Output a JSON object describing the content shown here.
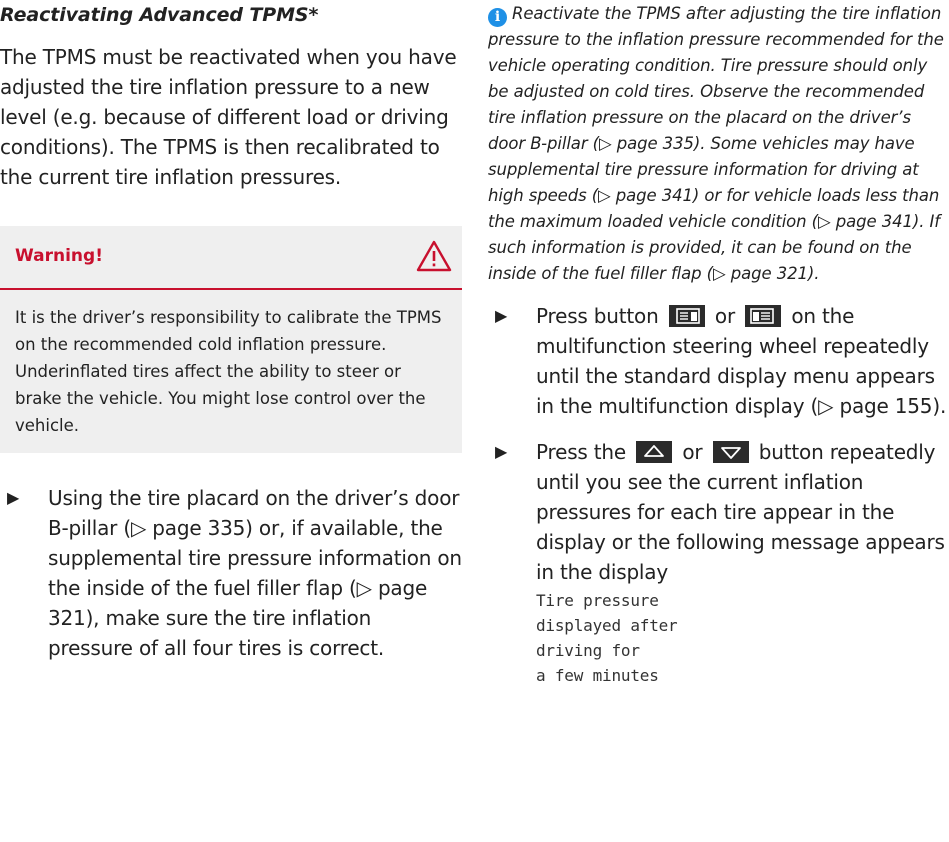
{
  "left": {
    "title": "Reactivating Advanced TPMS*",
    "intro": "The TPMS must be reactivated when you have adjusted the tire inflation pressure to a new level (e.g. because of different load or driving conditions). The TPMS is then recalibrated to the current tire inflation pressures.",
    "warning": {
      "label": "Warning!",
      "text": "It is the driver’s responsibility to calibrate the TPMS on the recommended cold inflation pressure. Underinflated tires affect the ability to steer or brake the vehicle. You might lose control over the vehicle."
    },
    "step": "Using the tire placard on the driver’s door B-pillar (▷ page 335) or, if available, the supplemental tire pressure information on the inside of the fuel filler flap (▷ page 321), make sure the tire inflation pressure of all four tires is correct."
  },
  "right": {
    "note": "Reactivate the TPMS after adjusting the tire inflation pressure to the inflation pressure recommended for the vehicle operating condition. Tire pressure should only be adjusted on cold tires. Observe the recommended tire inflation pressure on the placard on the driver’s door B-pillar (▷ page 335). Some vehicles may have supplemental tire pressure information for driving at high speeds (▷ page 341) or for vehicle loads less than the maximum loaded vehicle condition (▷ page 341). If such information is provided, it can be found on the inside of the fuel filler flap (▷ page 321).",
    "step1": {
      "before": "Press button",
      "or": "or",
      "after": "on the multifunction steering wheel repeatedly until the standard display menu appears in the multifunction display (▷ page 155)."
    },
    "step2": {
      "before": "Press the",
      "or": "or",
      "after": "button repeatedly until you see the current inflation pressures for each tire appear in the display or the following message appears in the display",
      "message": "Tire pressure\ndisplayed after\ndriving for\na few minutes"
    }
  },
  "icons": {
    "bullet": "▶",
    "info": "i",
    "warning": "warning-triangle-icon",
    "page_back": "display-page-back-icon",
    "page_forward": "display-page-forward-icon",
    "up": "up-arrow-icon",
    "down": "down-arrow-icon"
  },
  "colors": {
    "warning": "#c8102e",
    "info": "#1e90e6",
    "box_bg": "#efefef"
  }
}
